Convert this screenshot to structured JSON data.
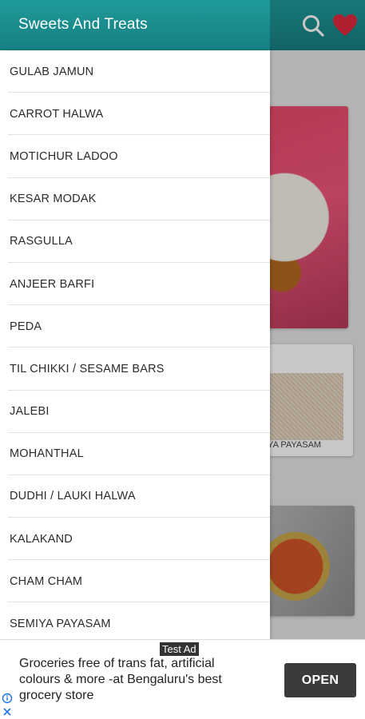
{
  "header": {
    "title": "Sweets And Treats",
    "icons": [
      "search-icon",
      "heart-icon"
    ],
    "color": "#1b8d8f"
  },
  "background": {
    "visible_caption": "IYA PAYASAM"
  },
  "drawer": {
    "items": [
      {
        "label": "GULAB JAMUN"
      },
      {
        "label": "CARROT HALWA"
      },
      {
        "label": "MOTICHUR LADOO"
      },
      {
        "label": "KESAR MODAK"
      },
      {
        "label": "RASGULLA"
      },
      {
        "label": "ANJEER BARFI"
      },
      {
        "label": "PEDA"
      },
      {
        "label": "TIL CHIKKI / SESAME BARS"
      },
      {
        "label": "JALEBI"
      },
      {
        "label": "MOHANTHAL"
      },
      {
        "label": "DUDHI / LAUKI HALWA"
      },
      {
        "label": "KALAKAND"
      },
      {
        "label": "CHAM CHAM"
      },
      {
        "label": "SEMIYA PAYASAM"
      }
    ]
  },
  "ad": {
    "tag": "Test Ad",
    "text": "Groceries free of trans fat, artificial colours & more -at Bengaluru's best grocery store",
    "button": "OPEN",
    "icons": [
      "info-icon",
      "close-icon"
    ]
  }
}
